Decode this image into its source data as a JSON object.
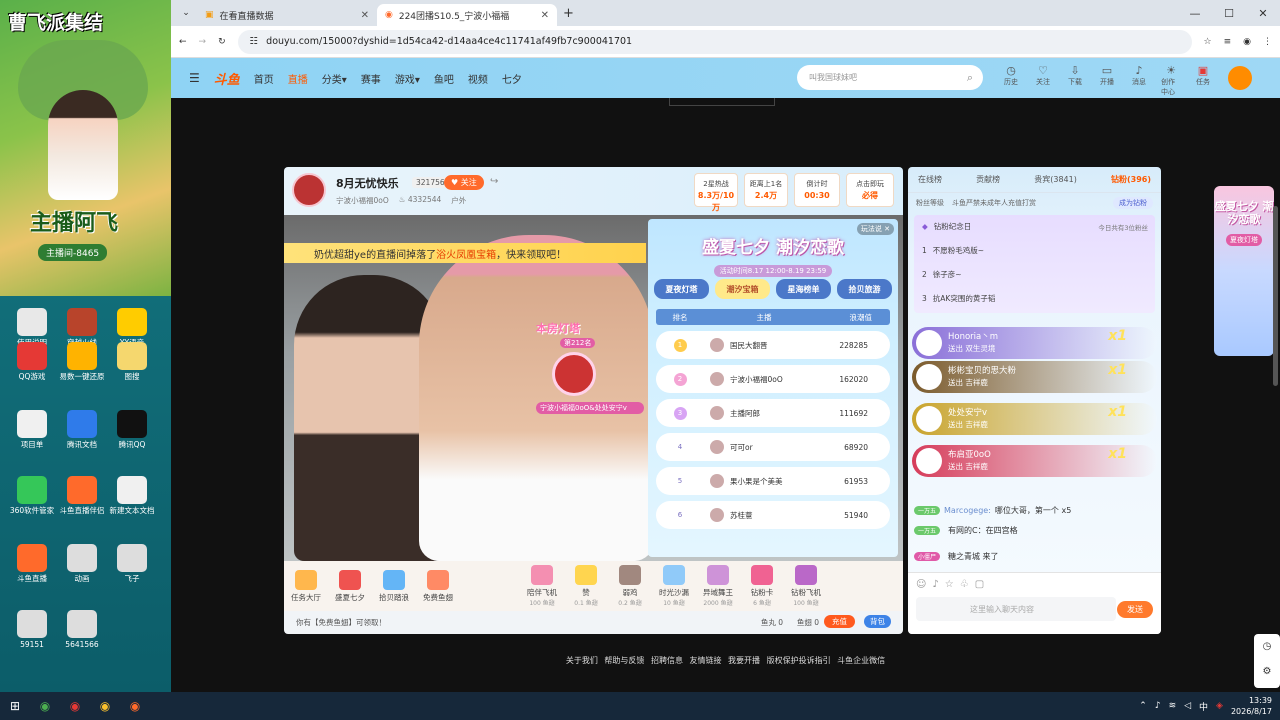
{
  "desktop": {
    "poster": {
      "title": "曹飞派集结",
      "name": "主播阿飞",
      "room_id": "主播间-8465"
    },
    "icons": [
      {
        "label": "使用说明",
        "icon": "doc-icon",
        "color": "#e8e8e8"
      },
      {
        "label": "穿越火线",
        "icon": "cf-game-icon",
        "color": "#b8442b"
      },
      {
        "label": "YY语音",
        "icon": "yy-icon",
        "color": "#ffcc00"
      },
      {
        "label": "QQ游戏",
        "icon": "qq-game-icon",
        "color": "#e53935"
      },
      {
        "label": "易数一键还原",
        "icon": "restore-icon",
        "color": "#ffb300"
      },
      {
        "label": "图搜",
        "icon": "folder-icon",
        "color": "#f5d76e"
      },
      {
        "label": "项目单",
        "icon": "doc-icon",
        "color": "#f0f0f0"
      },
      {
        "label": "腾讯文档",
        "icon": "tencent-docs-icon",
        "color": "#2f7bea"
      },
      {
        "label": "腾讯QQ",
        "icon": "qq-icon",
        "color": "#111"
      },
      {
        "label": "360软件管家",
        "icon": "360-icon",
        "color": "#35c759"
      },
      {
        "label": "斗鱼直播伴侣",
        "icon": "douyu-icon",
        "color": "#ff6a2b"
      },
      {
        "label": "新建文本文档",
        "icon": "text-doc-icon",
        "color": "#f0f0f0"
      },
      {
        "label": "斗鱼直播",
        "icon": "douyu-icon",
        "color": "#ff6a2b"
      },
      {
        "label": "动画",
        "icon": "image-icon",
        "color": "#ddd"
      },
      {
        "label": "飞子",
        "icon": "image-icon",
        "color": "#ddd"
      },
      {
        "label": "59151",
        "icon": "image-icon",
        "color": "#ddd"
      },
      {
        "label": "5641566",
        "icon": "image-icon",
        "color": "#ddd"
      }
    ]
  },
  "browser": {
    "tabs": [
      {
        "title": "在看直播数据"
      },
      {
        "title": "224团播S10.5_宁波小福福"
      }
    ],
    "url": "douyu.com/15000?dyshid=1d54ca42-d14aa4ce4c11741af49fb7c900041701"
  },
  "douyu": {
    "logo": "斗鱼",
    "nav": [
      "首页",
      "直播",
      "分类",
      "赛事",
      "游戏",
      "鱼吧",
      "视频",
      "七夕"
    ],
    "search_placeholder": "叫我国球妹吧",
    "header_icons": [
      "历史",
      "关注",
      "下载",
      "开播",
      "消息",
      "创作中心",
      "任务"
    ],
    "room": {
      "title": "8月无忧快乐",
      "fans": "321756",
      "follow": "关注",
      "anchor": "宁波小福福0oO",
      "hot": "4332544",
      "category": "户外",
      "stats": [
        {
          "label": "2星热战",
          "value": "8.3万/10万"
        },
        {
          "label": "距离上1名",
          "value": "2.4万"
        },
        {
          "label": "倒计时",
          "value": "00:30"
        },
        {
          "label": "点击即玩",
          "value": "必得"
        }
      ]
    },
    "banner": {
      "pre": "奶优超甜ye的直播间掉落了",
      "hl": "浴火凤凰宝箱",
      "post": "，快来领取吧！"
    },
    "popup": {
      "title": "盛夏七夕 潮汐恋歌",
      "date": "活动时间8.17 12:00-8.19 23:59",
      "close": "玩法说",
      "tabs": [
        "夏夜灯塔",
        "潮汐宝箱",
        "星海榜单",
        "拾贝旅游"
      ],
      "headers": [
        "排名",
        "主播",
        "浪潮值"
      ],
      "rows": [
        {
          "rank": "1",
          "name": "国民大翻晋",
          "value": "228285"
        },
        {
          "rank": "2",
          "name": "宁波小福福0oO",
          "value": "162020"
        },
        {
          "rank": "3",
          "name": "主播阿郎",
          "value": "111692"
        },
        {
          "rank": "4",
          "name": "可可or",
          "value": "68920"
        },
        {
          "rank": "5",
          "name": "果小果是个美美",
          "value": "61953"
        },
        {
          "rank": "6",
          "name": "苏桂薏",
          "value": "51940"
        }
      ]
    },
    "float_card": {
      "title": "本房灯塔",
      "rank": "第212名",
      "who": "宁波小福福0oO&处处安宁v"
    },
    "gifts": [
      {
        "name": "任务大厅",
        "sub": ""
      },
      {
        "name": "盛夏七夕",
        "sub": ""
      },
      {
        "name": "拾贝踏浪",
        "sub": ""
      },
      {
        "name": "免费鱼翅",
        "sub": ""
      },
      {
        "name": "陪伴飞机",
        "sub": "100 鱼翅"
      },
      {
        "name": "赞",
        "sub": "0.1 鱼翅"
      },
      {
        "name": "弱鸡",
        "sub": "0.2 鱼翅"
      },
      {
        "name": "时光沙漏",
        "sub": "10 鱼翅"
      },
      {
        "name": "异域舞王",
        "sub": "2000 鱼翅"
      },
      {
        "name": "钻粉卡",
        "sub": "6 鱼翅"
      },
      {
        "name": "钻粉飞机",
        "sub": "100 鱼翅"
      }
    ],
    "footer_bar": {
      "notice": "你有【免费鱼翅】可领取！",
      "fishball": "鱼丸 0",
      "fishfin": "鱼翅 0",
      "charge": "充值",
      "backpack": "背包"
    },
    "chat": {
      "tabs": [
        "在线榜",
        "贡献榜",
        "贵宾(3841)",
        "钻粉(396)"
      ],
      "fan_level": "粉丝等级",
      "notice": "斗鱼严禁未成年人充值打赏",
      "become_fan": "成为钻粉",
      "memo_title": "钻粉纪念日",
      "memo_right": "今日共有3位粉丝",
      "memo_rows": [
        "不愿粉毛鸡版~",
        "徐子彦~",
        "抗AK突围的黄子韬"
      ],
      "gifts": [
        {
          "user": "Honoria丶m",
          "act": "送出 双生灵境",
          "count": "x1",
          "color": "#8a6fd8"
        },
        {
          "user": "彬彬宝贝的思大粉",
          "act": "送出 吉祥鹿",
          "count": "x1",
          "color": "#7b5a2b"
        },
        {
          "user": "处处安宁v",
          "act": "送出 吉祥鹿",
          "count": "x1",
          "color": "#c9a42c"
        },
        {
          "user": "布启亚0oO",
          "act": "送出 吉祥鹿",
          "count": "x1",
          "color": "#d63c5a"
        }
      ],
      "msgs": [
        {
          "level": "一万五",
          "user": "Marcogege:",
          "text": "哪位大哥，第一个 x5"
        },
        {
          "level": "一万五",
          "user": "",
          "text": "有网的C：在四宫格"
        },
        {
          "level": "小僵尸",
          "user": "",
          "text": "糖之青城 来了"
        }
      ],
      "input_placeholder": "这里输入聊天内容",
      "send": "发送"
    },
    "footer": [
      "关于我们",
      "帮助与反馈",
      "招聘信息",
      "友情链接",
      "我要开播",
      "版权保护投诉指引",
      "斗鱼企业微信"
    ],
    "side_ad": {
      "title": "盛夏七夕 潮汐恋歌",
      "sub": "夏夜灯塔"
    }
  },
  "taskbar": {
    "time": "13:39",
    "date": "2026/8/17",
    "ime": "中"
  }
}
